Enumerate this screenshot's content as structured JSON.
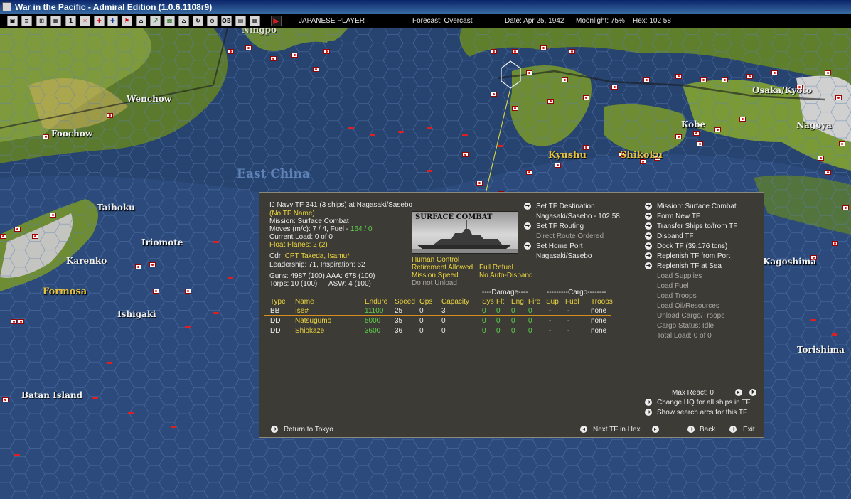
{
  "window": {
    "title": "War in the Pacific - Admiral Edition (1.0.6.1108r9)"
  },
  "toolbar": {
    "player": "JAPANESE PLAYER",
    "forecast": "Forecast: Overcast",
    "date": "Date: Apr 25, 1942",
    "moonlight": "Moonlight: 75%",
    "hex": "Hex: 102 58",
    "buttons": [
      "▣",
      "≡",
      "⊞",
      "▦",
      "1",
      "☀",
      "✚",
      "✚",
      "⚑",
      "⌂",
      "♐",
      "▩",
      "⌂",
      "↻",
      "⊙",
      "OB",
      "▤",
      "▦"
    ]
  },
  "map": {
    "labels": {
      "wenchow": "Wenchow",
      "foochow": "Foochow",
      "taihoku": "Taihoku",
      "iriomote": "Iriomote",
      "karenko": "Karenko",
      "formosa": "Formosa",
      "ishigaki": "Ishigaki",
      "batan": "Batan Island",
      "east_china": "East China",
      "kyushu": "Kyushu",
      "shikoku": "Shikoku",
      "kobe": "Kobe",
      "osaka": "Osaka/Kyoto",
      "nagoya": "Nagoya",
      "kagoshima": "Kagoshima",
      "torishima": "Torishima",
      "ningpo": "Ningpo"
    }
  },
  "panel": {
    "header": "IJ Navy TF 341 (3 ships) at Nagasaki/Sasebo",
    "tf_name": "(No TF Name)",
    "mission": "Mission: Surface Combat",
    "moves_prefix": "Moves (m/c): 7 / 4, Fuel - ",
    "moves_fuel": "164 / 0",
    "current_load": "Current Load: 0 of 0",
    "float_planes": "Float Planes: 2 (2)",
    "cdr_label": "Cdr:",
    "cdr_name": "CPT Takeda, Isamu*",
    "leadership": "Leadership: 71, Inspiration: 62",
    "guns": "Guns: 4987 (100)  AAA: 678 (100)",
    "torps": "Torps: 10 (100)",
    "asw": "ASW: 4 (100)",
    "photo_caption": "SURFACE COMBAT",
    "flags": {
      "human_control": "Human Control",
      "retirement": "Retirement Allowed",
      "full_refuel": "Full Refuel",
      "mission_speed": "Mission Speed",
      "no_disband": "No Auto-Disband",
      "do_not_unload": "Do not Unload"
    },
    "mid_actions": {
      "set_destination": "Set TF Destination",
      "destination_value": "Nagasaki/Sasebo - 102,58",
      "set_routing": "Set TF Routing",
      "routing_value": "Direct Route Ordered",
      "set_home": "Set Home Port",
      "home_value": "Nagasaki/Sasebo"
    },
    "right_actions": [
      "Mission: Surface Combat",
      "Form New TF",
      "Transfer Ships to/from TF",
      "Disband TF",
      "Dock TF (39,176 tons)",
      "Replenish TF from Port",
      "Replenish TF at Sea"
    ],
    "right_disabled": [
      "Load Supplies",
      "Load Fuel",
      "Load Troops",
      "Load Oil/Resources",
      "Unload Cargo/Troops",
      "Cargo Status: Idle",
      "Total Load: 0 of 0"
    ],
    "group_headers": {
      "damage": "----Damage----",
      "cargo": "---------Cargo--------"
    },
    "table": {
      "headers": [
        "Type",
        "Name",
        "Endure",
        "Speed",
        "Ops",
        "Capacity",
        "Sys",
        "Flt",
        "Eng",
        "Fire",
        "Sup",
        "Fuel",
        "Troops"
      ],
      "rows": [
        [
          "BB",
          "Ise#",
          "11100",
          "25",
          "0",
          "3",
          "0",
          "0",
          "0",
          "0",
          "-",
          "-",
          "none"
        ],
        [
          "DD",
          "Natsugumo",
          "5000",
          "35",
          "0",
          "0",
          "0",
          "0",
          "0",
          "0",
          "-",
          "-",
          "none"
        ],
        [
          "DD",
          "Shiokaze",
          "3600",
          "36",
          "0",
          "0",
          "0",
          "0",
          "0",
          "0",
          "-",
          "-",
          "none"
        ]
      ]
    },
    "max_react": "Max React:  0",
    "change_hq": "Change HQ for all ships in TF",
    "show_search": "Show search arcs for this TF",
    "return": "Return to Tokyo",
    "next_tf": "Next TF in Hex",
    "back": "Back",
    "exit": "Exit"
  }
}
